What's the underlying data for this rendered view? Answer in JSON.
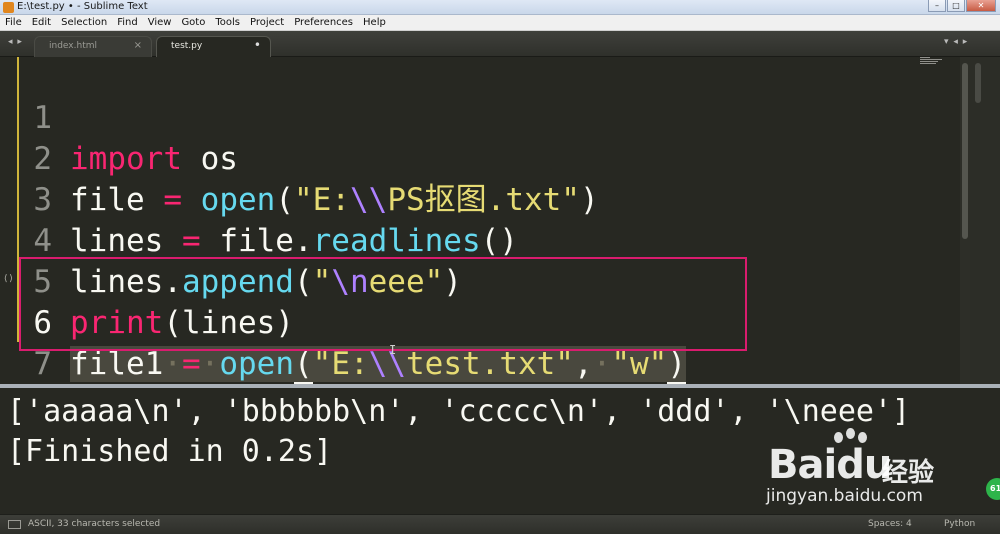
{
  "window": {
    "title": "E:\\test.py • - Sublime Text",
    "controls": [
      "–",
      "□",
      "✕"
    ]
  },
  "menu": [
    "File",
    "Edit",
    "Selection",
    "Find",
    "View",
    "Goto",
    "Tools",
    "Project",
    "Preferences",
    "Help"
  ],
  "tabs": {
    "nav_left": "◂ ▸",
    "nav_right": "▾  ◂ ▸",
    "items": [
      {
        "label": "index.html",
        "close": "×",
        "active": false
      },
      {
        "label": "test.py",
        "close": "•",
        "active": true
      }
    ]
  },
  "editor": {
    "fold_marker": "⟨⟩",
    "line_numbers": [
      "1",
      "2",
      "3",
      "4",
      "5",
      "6",
      "7"
    ],
    "current_line": 6,
    "lines": [
      "import os",
      "file = open(\"E:\\\\PS抠图.txt\")",
      "lines = file.readlines()",
      "lines.append(\"\\neee\")",
      "print(lines)",
      "file1 = open(\"E:\\\\test.txt\", \"w\")",
      ""
    ]
  },
  "output": {
    "lines": [
      "['aaaaa\\n', 'bbbbbb\\n', 'ccccc\\n', 'ddd', '\\neee']",
      "[Finished in 0.2s]"
    ]
  },
  "watermark": {
    "logo": "Bai",
    "logo_suffix": "du",
    "brand": "经验",
    "url": "jingyan.baidu.com",
    "badge": "61"
  },
  "statusbar": {
    "left": "ASCII, 33 characters selected",
    "spaces": "Spaces: 4",
    "syntax": "Python"
  },
  "colors": {
    "background": "#272822",
    "keyword": "#f92672",
    "function": "#66d9ef",
    "string": "#e6db74",
    "escape": "#ae81ff",
    "highlight_box": "#d91c6e"
  }
}
